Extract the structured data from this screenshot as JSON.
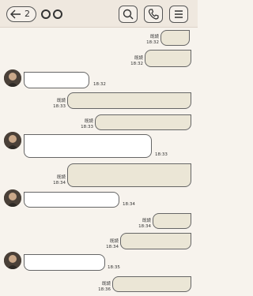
{
  "header": {
    "back_count": "2",
    "icons": [
      "search-icon",
      "phone-icon",
      "menu-icon"
    ]
  },
  "messages": [
    {
      "dir": "out",
      "read": "既読",
      "time": "18:32"
    },
    {
      "dir": "out",
      "read": "既読",
      "time": "18:32"
    },
    {
      "dir": "in",
      "time": "18:32"
    },
    {
      "dir": "out",
      "read": "既読",
      "time": "18:33"
    },
    {
      "dir": "out",
      "read": "既読",
      "time": "18:33"
    },
    {
      "dir": "in",
      "time": "18:33"
    },
    {
      "dir": "out",
      "read": "既読",
      "time": "18:34"
    },
    {
      "dir": "in",
      "time": "18:34"
    },
    {
      "dir": "out",
      "read": "既読",
      "time": "18:34"
    },
    {
      "dir": "out",
      "read": "既読",
      "time": "18:34"
    },
    {
      "dir": "in",
      "time": "18:35"
    },
    {
      "dir": "out",
      "read": "既読",
      "time": "18:36"
    }
  ],
  "colors": {
    "background": "#f7f3ed",
    "header": "#efe8df",
    "outgoing_bubble": "#ebe6d6",
    "incoming_bubble": "#ffffff"
  }
}
